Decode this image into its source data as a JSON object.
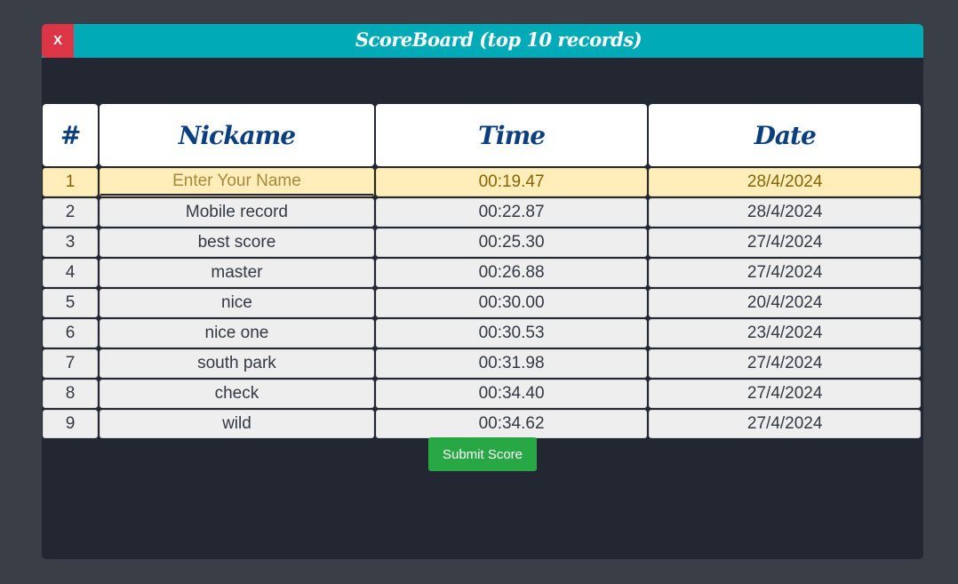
{
  "modal": {
    "close_label": "X",
    "title": "ScoreBoard (top 10 records)"
  },
  "table": {
    "headers": [
      "#",
      "Nickame",
      "Time",
      "Date"
    ],
    "input_placeholder": "Enter Your Name",
    "rows": [
      {
        "rank": "1",
        "nickname": "",
        "time": "00:19.47",
        "date": "28/4/2024",
        "current": true
      },
      {
        "rank": "2",
        "nickname": "Mobile record",
        "time": "00:22.87",
        "date": "28/4/2024"
      },
      {
        "rank": "3",
        "nickname": "best score",
        "time": "00:25.30",
        "date": "27/4/2024"
      },
      {
        "rank": "4",
        "nickname": "master",
        "time": "00:26.88",
        "date": "27/4/2024"
      },
      {
        "rank": "5",
        "nickname": "nice",
        "time": "00:30.00",
        "date": "20/4/2024"
      },
      {
        "rank": "6",
        "nickname": "nice one",
        "time": "00:30.53",
        "date": "23/4/2024"
      },
      {
        "rank": "7",
        "nickname": "south park",
        "time": "00:31.98",
        "date": "27/4/2024"
      },
      {
        "rank": "8",
        "nickname": "check",
        "time": "00:34.40",
        "date": "27/4/2024"
      },
      {
        "rank": "9",
        "nickname": "wild",
        "time": "00:34.62",
        "date": "27/4/2024"
      }
    ]
  },
  "actions": {
    "submit_label": "Submit Score"
  },
  "colors": {
    "page_background": "#3a3e47",
    "modal_background": "#222731",
    "header_accent": "#00aab6",
    "close_button": "#dc3545",
    "submit_button": "#28a745",
    "highlight_row": "#ffeeba",
    "header_text": "#0b3f7f"
  }
}
